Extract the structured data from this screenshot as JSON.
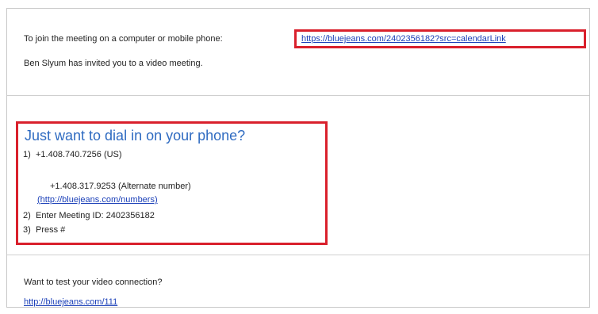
{
  "intro": {
    "text": "To join the meeting on a computer or mobile phone:",
    "join_link": "https://bluejeans.com/2402356182?src=calendarLink"
  },
  "invite_text": "Ben Slyum has invited you to a video meeting.",
  "dial_in": {
    "heading": "Just want to dial in on your phone?",
    "step1_num": "1)",
    "step1_text": "+1.408.740.7256 (US)",
    "step1_alt_number": "+1.408.317.9253 (Alternate number)",
    "step1_link": "(http://bluejeans.com/numbers)",
    "step2_num": "2)",
    "step2_text": "Enter Meeting ID: 2402356182",
    "step3_num": "3)",
    "step3_text": "Press #"
  },
  "test": {
    "question": "Want to test your video connection?",
    "link": "http://bluejeans.com/111"
  },
  "colors": {
    "highlight_border": "#d9202c",
    "link": "#1a3fb8",
    "heading": "#2f6bc1"
  }
}
